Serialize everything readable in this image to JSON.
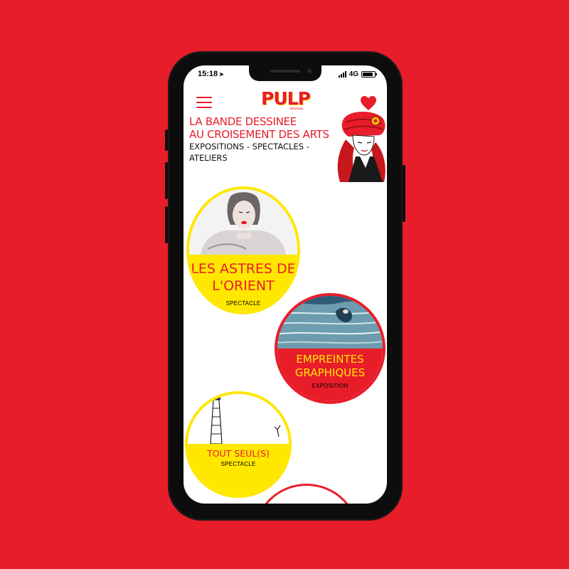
{
  "status_bar": {
    "time": "15:18",
    "network": "4G"
  },
  "header": {
    "logo": "PULP",
    "logo_sub": "FESTIVAL"
  },
  "intro": {
    "title_line1": "LA BANDE DESSINEE",
    "title_line2": "AU CROISEMENT DES ARTS",
    "subtitle_line1": "EXPOSITIONS - SPECTACLES -",
    "subtitle_line2": "ATELIERS"
  },
  "cards": [
    {
      "title_line1": "LES ASTRES DE",
      "title_line2": "L'ORIENT",
      "kind": "SPECTACLE"
    },
    {
      "title_line1": "EMPREINTES",
      "title_line2": "GRAPHIQUES",
      "kind": "EXPOSITION"
    },
    {
      "title": "TOUT SEUL(S)",
      "kind": "SPECTACLE"
    }
  ],
  "colors": {
    "background": "#e81d2a",
    "accent_yellow": "#ffe700",
    "accent_red": "#e81d2a"
  },
  "icons": [
    "menu-icon",
    "heart-icon",
    "location-arrow-icon",
    "signal-icon",
    "battery-icon"
  ]
}
